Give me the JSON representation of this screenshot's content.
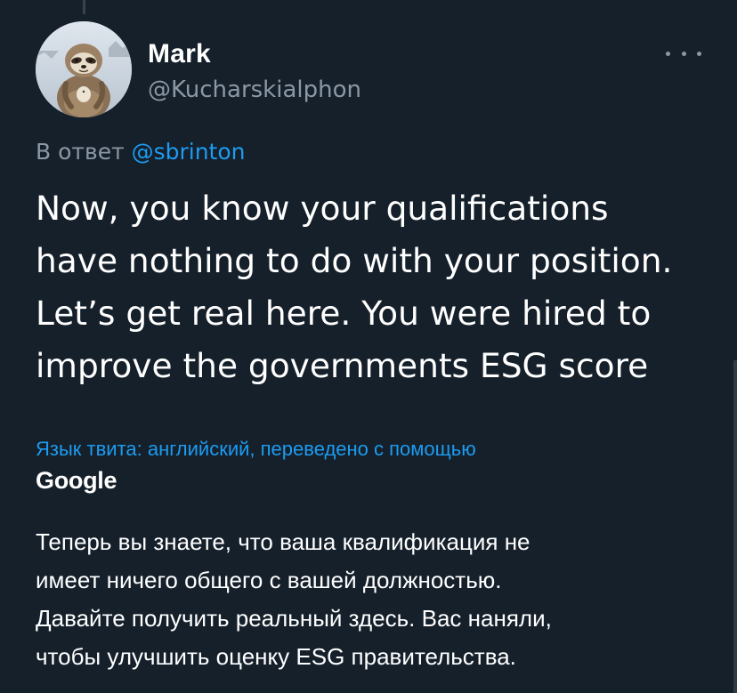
{
  "tweet": {
    "author": {
      "display_name": "Mark",
      "handle": "@Kucharskialphon"
    },
    "reply_prefix": "В ответ",
    "reply_mention": "@sbrinton",
    "text_lines": [
      "Now, you know your qualifications",
      "have nothing to do with your position.",
      "Let’s get real here.  You were hired to",
      "improve the governments ESG score"
    ],
    "translation": {
      "info": "Язык твита: английский, переведено с помощью",
      "provider": "Google",
      "lines": [
        "Теперь вы знаете, что ваша квалификация не",
        "имеет ничего общего с вашей должностью.",
        "Давайте получить реальный здесь. Вас наняли,",
        "чтобы улучшить оценку ESG правительства."
      ]
    }
  },
  "icons": {
    "more": "more-horizontal-icon",
    "avatar": "sloth-avatar"
  },
  "colors": {
    "background": "#15202b",
    "primary_text": "#ffffff",
    "secondary_text": "#8b98a5",
    "accent": "#1d9bf0"
  }
}
